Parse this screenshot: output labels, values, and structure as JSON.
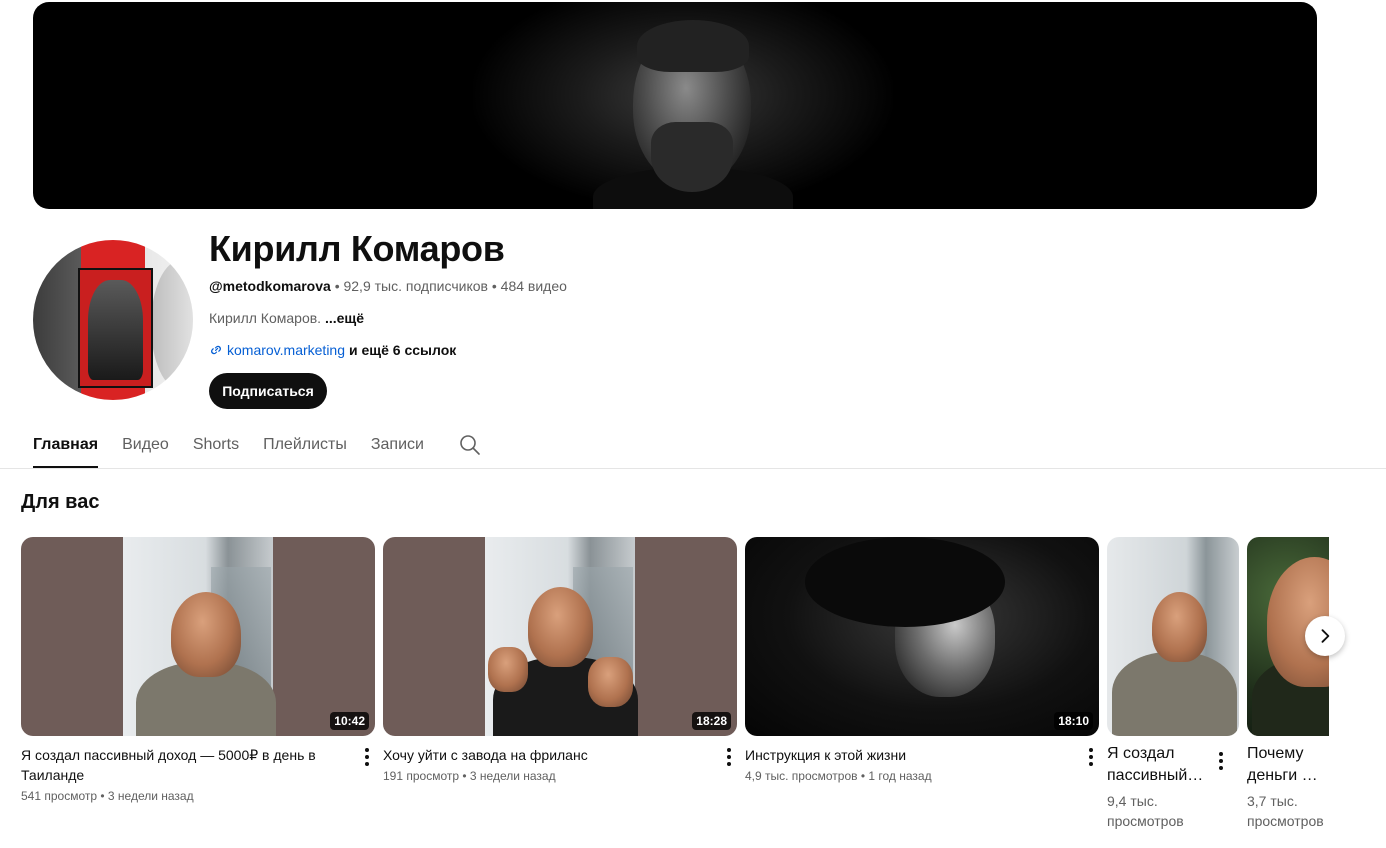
{
  "channel": {
    "name": "Кирилл Комаров",
    "handle": "@metodkomarova",
    "subscribers": "92,9 тыс. подписчиков",
    "videos_count": "484 видео",
    "separator": "•",
    "description": "Кирилл Комаров.",
    "description_more": "...ещё",
    "link": "komarov.marketing",
    "links_more": "и ещё 6 ссылок",
    "subscribe_label": "Подписаться"
  },
  "tabs": [
    {
      "label": "Главная",
      "active": true
    },
    {
      "label": "Видео",
      "active": false
    },
    {
      "label": "Shorts",
      "active": false
    },
    {
      "label": "Плейлисты",
      "active": false
    },
    {
      "label": "Записи",
      "active": false
    }
  ],
  "section": {
    "title": "Для вас"
  },
  "videos": [
    {
      "title_line1": "Я создал пассивный доход — 5000₽ в день в",
      "title_line2": "Таиланде",
      "meta": "541 просмотр • 3 недели назад",
      "duration": "10:42"
    },
    {
      "title_line1": "Хочу уйти с завода на фриланс",
      "meta": "191 просмотр • 3 недели назад",
      "duration": "18:28"
    },
    {
      "title_line1": "Инструкция к этой жизни",
      "meta": "4,9 тыс. просмотров • 1 год назад",
      "duration": "18:10"
    },
    {
      "title_line1": "Я создал",
      "title_line2": "пассивный…",
      "meta_line1": "9,4 тыс.",
      "meta_line2": "просмотров"
    },
    {
      "title_line1": "Почему",
      "title_line2": "деньги …",
      "meta_line1": "3,7 тыс.",
      "meta_line2": "просмотров"
    }
  ],
  "icons": {
    "link": "link-icon",
    "search": "search-icon",
    "more": "more-vert-icon",
    "next": "chevron-right-icon"
  },
  "colors": {
    "link": "#065fd4",
    "subscribe_bg": "#0f0f0f",
    "secondary_text": "#606060"
  }
}
